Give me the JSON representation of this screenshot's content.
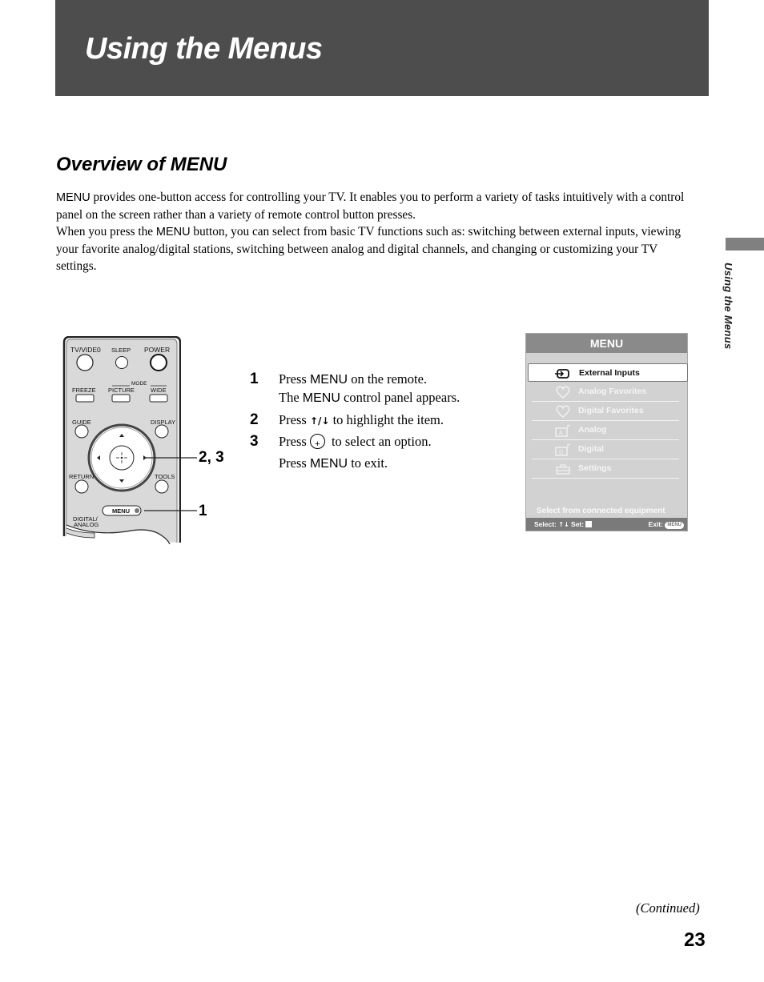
{
  "header": {
    "title": "Using the Menus"
  },
  "section": {
    "title": "Overview of MENU",
    "paragraph1": {
      "menu_word": "MENU",
      "text": " provides one-button access for controlling your TV. It enables you to perform a variety of tasks intuitively with a control panel on the screen rather than a variety of remote control button presses."
    },
    "paragraph2": {
      "before": "When you press the ",
      "menu_word": "MENU",
      "after": " button, you can select from basic TV functions such as: switching between external inputs, viewing your favorite analog/digital stations, switching between analog and digital channels, and changing or customizing your TV settings."
    }
  },
  "side_tab": {
    "label": "Using the Menus"
  },
  "remote": {
    "buttons": {
      "tv_video": "TV/VIDE0",
      "sleep": "SLEEP",
      "power": "POWER",
      "mode": "MODE",
      "freeze": "FREEZE",
      "picture": "PICTURE",
      "wide": "WIDE",
      "guide": "GUIDE",
      "display": "DISPLAY",
      "return": "RETURN",
      "tools": "TOOLS",
      "menu": "MENU",
      "digital_analog_1": "DIGITAL/",
      "digital_analog_2": "ANALOG"
    },
    "callouts": {
      "navigation": "2, 3",
      "menu": "1"
    }
  },
  "steps": [
    {
      "number": "1",
      "line1_before": "Press ",
      "line1_menu": "MENU",
      "line1_after": " on the remote.",
      "line2_before": "The ",
      "line2_menu": "MENU",
      "line2_after": " control panel appears."
    },
    {
      "number": "2",
      "before": "Press ",
      "arrows": "↑/↓",
      "after": " to highlight the item."
    },
    {
      "number": "3",
      "before": "Press",
      "after": "to select an option.",
      "line2_before": "Press ",
      "line2_menu": "MENU",
      "line2_after": " to exit."
    }
  ],
  "menu_screen": {
    "title": "MENU",
    "items": [
      {
        "label": "External Inputs",
        "icon": "input-icon",
        "selected": true
      },
      {
        "label": "Analog Favorites",
        "icon": "heart-icon",
        "selected": false
      },
      {
        "label": "Digital Favorites",
        "icon": "heart-icon",
        "selected": false
      },
      {
        "label": "Analog",
        "icon": "analog-tv-icon",
        "selected": false
      },
      {
        "label": "Digital",
        "icon": "digital-tv-icon",
        "selected": false
      },
      {
        "label": "Settings",
        "icon": "toolbox-icon",
        "selected": false
      }
    ],
    "hint": "Select from connected equipment",
    "footer": {
      "select": "Select:",
      "arrows": "↑↓",
      "set": "Set:",
      "exit": "Exit:",
      "exit_key": "MENU"
    }
  },
  "continued": "(Continued)",
  "page_number": "23"
}
